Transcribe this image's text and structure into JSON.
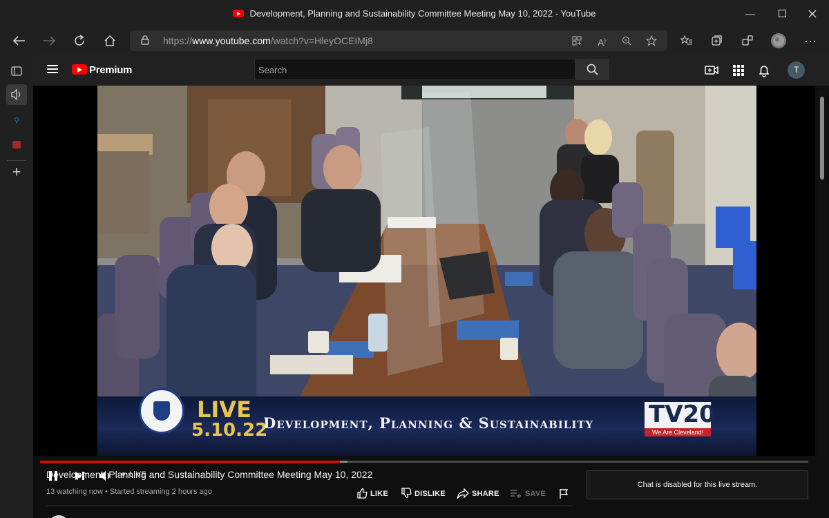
{
  "browser": {
    "window_title": "Development, Planning and Sustainability Committee Meeting May 10, 2022 - YouTube",
    "url_prefix": "https://",
    "url_host": "www.youtube.com",
    "url_path": "/watch?v=HleyOCEIMj8"
  },
  "youtube": {
    "brand": "Premium",
    "search_placeholder": "Search",
    "avatar_letter": "T"
  },
  "video": {
    "banner_live": "LIVE",
    "banner_date": "5.10.22",
    "banner_committee": "Development, Planning & Sustainability",
    "station_logo": "TV20",
    "station_tagline": "We Are Cleveland!",
    "live_label": "LIVE",
    "cc_label": "CC",
    "progress_percent": 39
  },
  "info": {
    "title": "Development, Planning and Sustainability Committee Meeting May 10, 2022",
    "meta": "13 watching now • Started streaming 2 hours ago",
    "like": "LIKE",
    "dislike": "DISLIKE",
    "share": "SHARE",
    "save": "SAVE",
    "chat_disabled": "Chat is disabled for this live stream."
  },
  "colors": {
    "accent": "#ff0000",
    "banner_gold": "#e8c64a",
    "banner_navy": "#1b2a58"
  }
}
